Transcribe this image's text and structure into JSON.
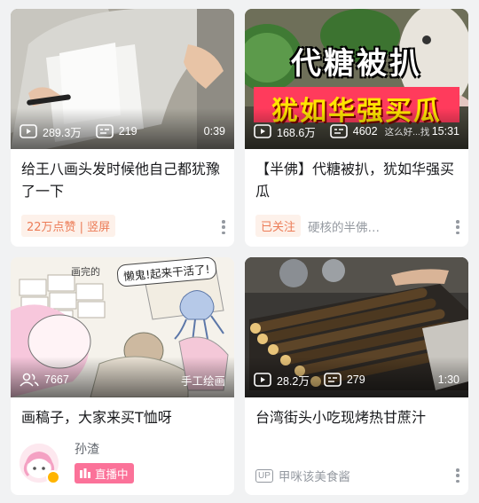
{
  "cards": [
    {
      "views": "289.3万",
      "danmaku": "219",
      "duration": "0:39",
      "title": "给王八画头发时候他自己都犹豫了一下",
      "tag": "22万点赞 | 竖屏"
    },
    {
      "banner_line1": "代糖被扒",
      "banner_line2": "犹如华强买瓜",
      "overlay_text": "这么好...找茬",
      "views": "168.6万",
      "danmaku": "4602",
      "duration": "15:31",
      "title": "【半佛】代糖被扒，犹如华强买瓜",
      "tag": "已关注",
      "uploader": "硬核的半佛…"
    },
    {
      "thumb_text_top": "画完的",
      "thumb_text_bubble": "懒鬼!起来干活了!",
      "followers": "7667",
      "note": "手工绘画",
      "title": "画稿子，大家来买T恤呀",
      "uploader": "孙渣",
      "live": "直播中"
    },
    {
      "views": "28.2万",
      "danmaku": "279",
      "duration": "1:30",
      "title": "台湾街头小吃现烤热甘蔗汁",
      "up_label": "UP",
      "uploader": "甲咪该美食酱"
    }
  ]
}
